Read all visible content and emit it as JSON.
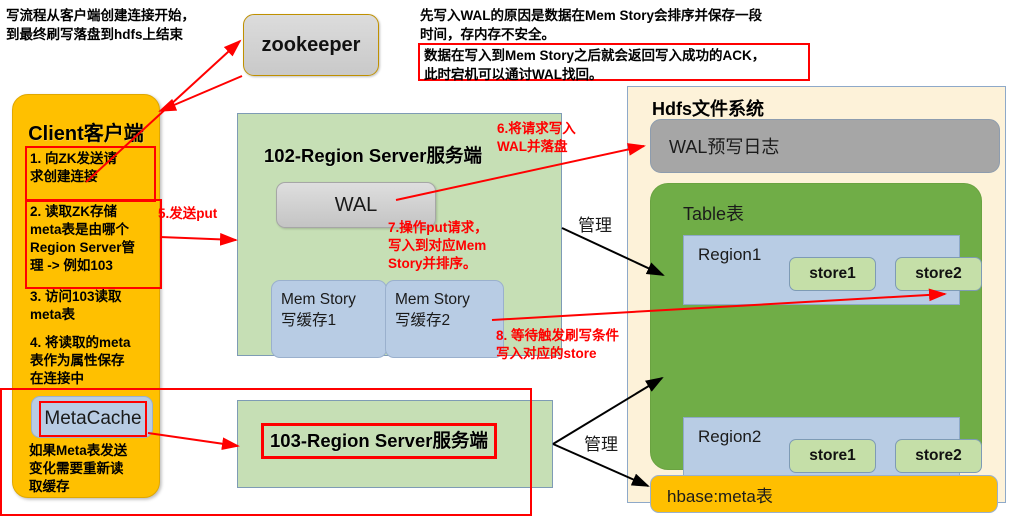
{
  "notes": {
    "top_left": "写流程从客户端创建连接开始，\n到最终刷写落盘到hdfs上结束",
    "top_right_plain": "先写入WAL的原因是数据在Mem Story会排序并保存一段\n时间，存内存不安全。",
    "top_right_boxed": "数据在写入到Mem Story之后就会返回写入成功的ACK，\n此时宕机可以通讨WAL找回。"
  },
  "zookeeper": {
    "label": "zookeeper"
  },
  "client": {
    "title": "Client客户端",
    "steps": [
      "1. 向ZK发送请\n求创建连接",
      "2. 读取ZK存储\nmeta表是由哪个\nRegion Server管\n理 -> 例如103",
      "3. 访问103读取\nmeta表",
      "4. 将读取的meta\n表作为属性保存\n在连接中"
    ],
    "metacache_label": "MetaCache",
    "footer": "如果Meta表发送\n变化需要重新读\n取缓存"
  },
  "region_server_102": {
    "title": "102-Region Server服务端",
    "wal_label": "WAL",
    "mem_stores": [
      "Mem Story\n写缓存1",
      "Mem Story\n写缓存2"
    ]
  },
  "region_server_103": {
    "title": "103-Region Server服务端"
  },
  "hdfs": {
    "title": "Hdfs文件系统",
    "wal_log": "WAL预写日志",
    "table_label": "Table表",
    "regions": [
      {
        "label": "Region1",
        "stores": [
          "store1",
          "store2"
        ]
      },
      {
        "label": "Region2",
        "stores": [
          "store1",
          "store2"
        ]
      }
    ],
    "meta_table": "hbase:meta表"
  },
  "annotations": {
    "step5": "5.发送put",
    "step6": "6.将请求写入\nWAL并落盘",
    "step7": "7.操作put请求，\n写入到对应Mem\nStory并排序。",
    "step8": "8. 等待触发刷写条件\n写入对应的store",
    "manage_top": "管理",
    "manage_bottom": "管理"
  },
  "colors": {
    "client_orange": "#ffc000",
    "region_server_green": "#c6dfb5",
    "hdfs_cream": "#fdf2d9",
    "table_green": "#70ad47",
    "region_blue": "#b8cce4",
    "store_green": "#c5dfa8",
    "wal_gray": "#a6a6a6",
    "annotation_red": "#ff0000",
    "meta_orange": "#ffbf00"
  }
}
